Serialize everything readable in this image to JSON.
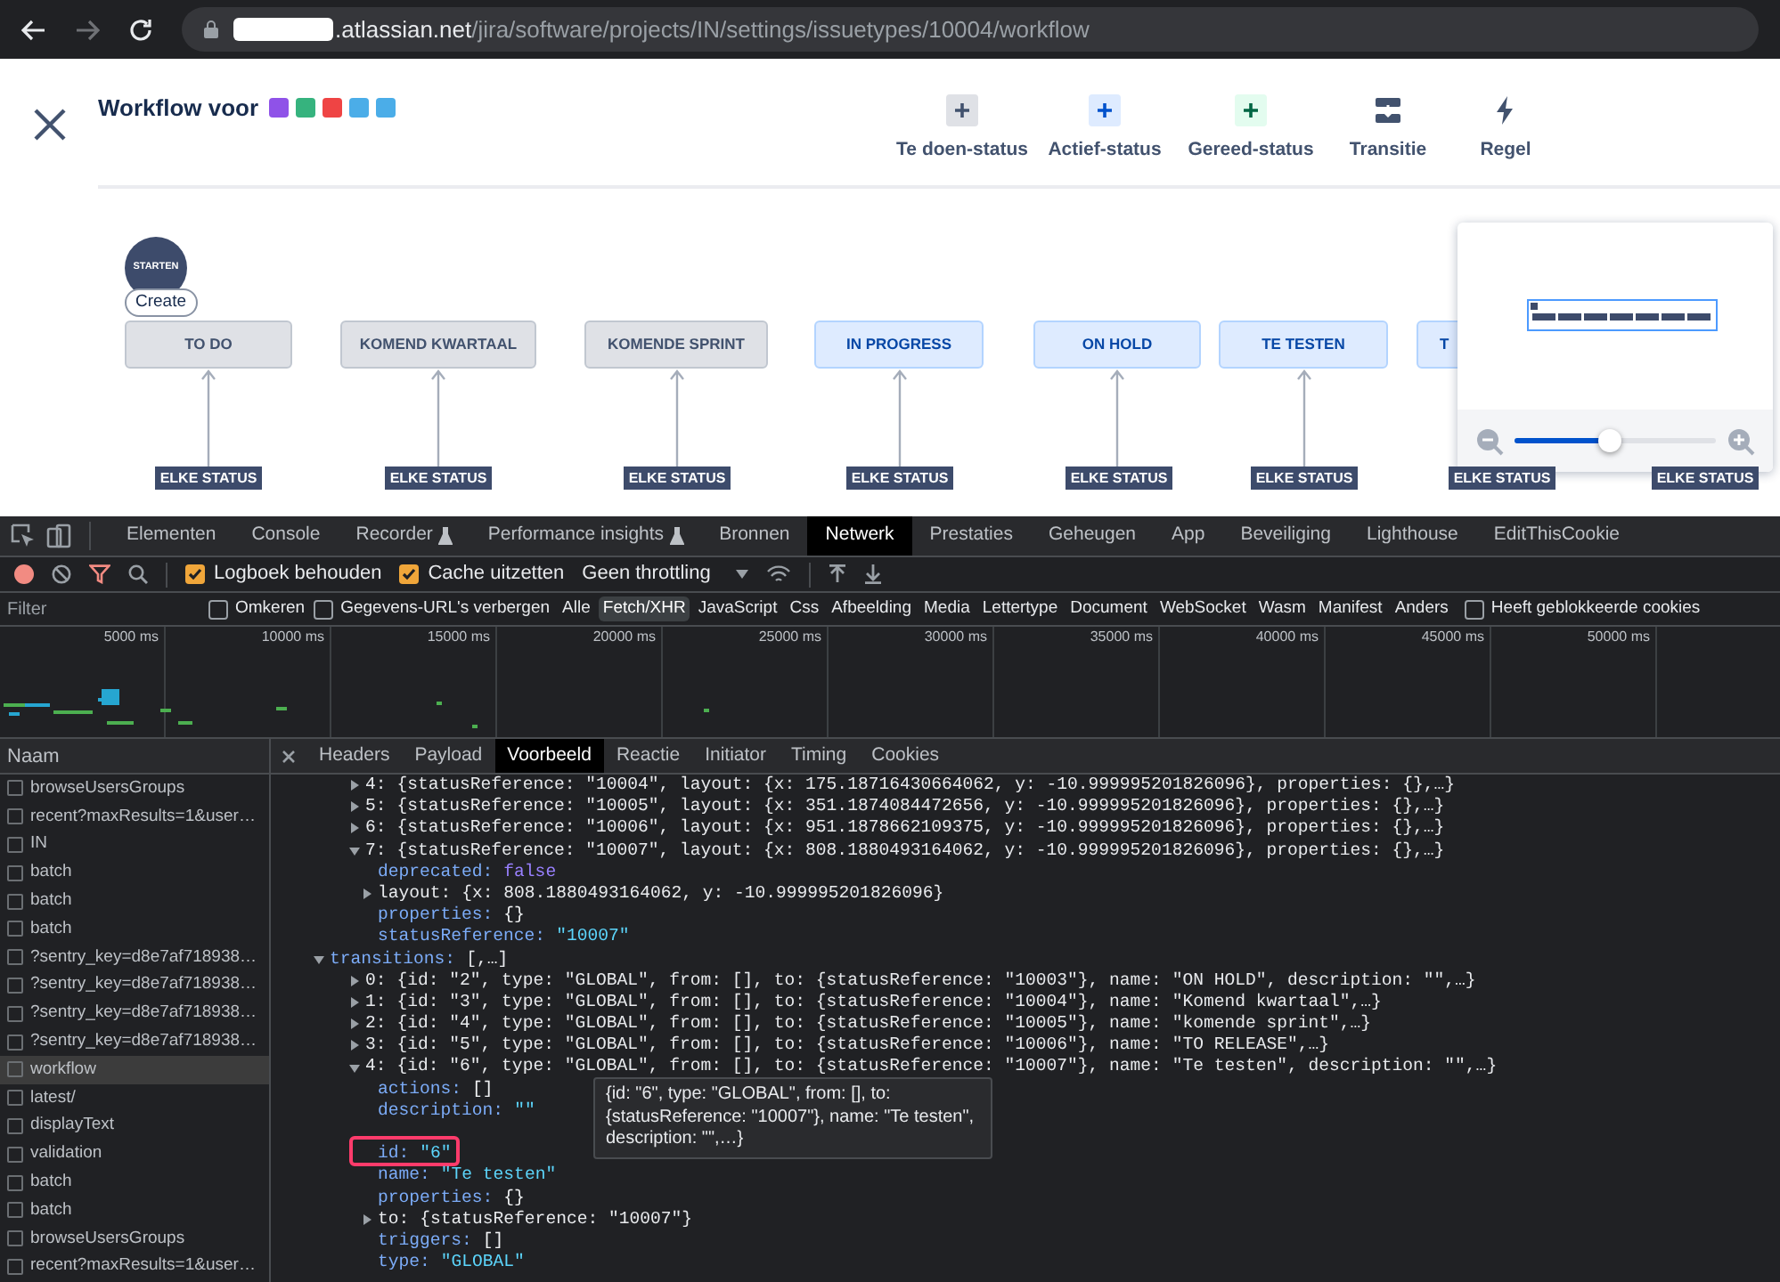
{
  "browser": {
    "url_host": ".atlassian.net",
    "url_path": "/jira/software/projects/IN/settings/issuetypes/10004/workflow"
  },
  "header": {
    "title": "Workflow voor",
    "issue_types": [
      {
        "color": "#8f52e8"
      },
      {
        "color": "#36b37e"
      },
      {
        "color": "#ef4444"
      },
      {
        "color": "#4bade8"
      },
      {
        "color": "#4bade8"
      }
    ],
    "tools": [
      {
        "label": "Te doen-status",
        "kind": "todo"
      },
      {
        "label": "Actief-status",
        "kind": "active"
      },
      {
        "label": "Gereed-status",
        "kind": "done"
      },
      {
        "label": "Transitie",
        "kind": "transition"
      },
      {
        "label": "Regel",
        "kind": "rule"
      }
    ]
  },
  "canvas": {
    "start": "STARTEN",
    "create": "Create",
    "statuses": [
      {
        "label": "TO DO",
        "kind": "todo",
        "has_arrow": true
      },
      {
        "label": "KOMEND KWARTAAL",
        "kind": "todo",
        "has_arrow": true
      },
      {
        "label": "KOMENDE SPRINT",
        "kind": "todo",
        "has_arrow": true
      },
      {
        "label": "IN PROGRESS",
        "kind": "inprogress",
        "has_arrow": true
      },
      {
        "label": "ON HOLD",
        "kind": "inprogress",
        "has_arrow": true
      },
      {
        "label": "TE TESTEN",
        "kind": "inprogress",
        "has_arrow": true
      },
      {
        "label": "T",
        "kind": "inprogress",
        "has_arrow": false
      }
    ],
    "global_labels": [
      "ELKE STATUS",
      "ELKE STATUS",
      "ELKE STATUS",
      "ELKE STATUS",
      "ELKE STATUS",
      "ELKE STATUS",
      "ELKE STATUS",
      "ELKE STATUS"
    ],
    "zoom": {
      "level": 0.47
    }
  },
  "devtools": {
    "tabs": [
      {
        "label": "Elementen",
        "selected": false,
        "lab": false
      },
      {
        "label": "Console",
        "selected": false,
        "lab": false
      },
      {
        "label": "Recorder",
        "selected": false,
        "lab": true
      },
      {
        "label": "Performance insights",
        "selected": false,
        "lab": true
      },
      {
        "label": "Bronnen",
        "selected": false,
        "lab": false
      },
      {
        "label": "Netwerk",
        "selected": true,
        "lab": false
      },
      {
        "label": "Prestaties",
        "selected": false,
        "lab": false
      },
      {
        "label": "Geheugen",
        "selected": false,
        "lab": false
      },
      {
        "label": "App",
        "selected": false,
        "lab": false
      },
      {
        "label": "Beveiliging",
        "selected": false,
        "lab": false
      },
      {
        "label": "Lighthouse",
        "selected": false,
        "lab": false
      },
      {
        "label": "EditThisCookie",
        "selected": false,
        "lab": false
      }
    ],
    "toolbar": {
      "preserve_log": {
        "label": "Logboek behouden",
        "checked": true
      },
      "disable_cache": {
        "label": "Cache uitzetten",
        "checked": true
      },
      "throttling": "Geen throttling"
    },
    "filter": {
      "placeholder": "Filter",
      "invert": {
        "label": "Omkeren",
        "checked": false
      },
      "hide_data_urls": {
        "label": "Gegevens-URL's verbergen",
        "checked": false
      },
      "types": [
        {
          "label": "Alle",
          "selected": false
        },
        {
          "label": "Fetch/XHR",
          "selected": true
        },
        {
          "label": "JavaScript",
          "selected": false
        },
        {
          "label": "Css",
          "selected": false
        },
        {
          "label": "Afbeelding",
          "selected": false
        },
        {
          "label": "Media",
          "selected": false
        },
        {
          "label": "Lettertype",
          "selected": false
        },
        {
          "label": "Document",
          "selected": false
        },
        {
          "label": "WebSocket",
          "selected": false
        },
        {
          "label": "Wasm",
          "selected": false
        },
        {
          "label": "Manifest",
          "selected": false
        },
        {
          "label": "Anders",
          "selected": false
        }
      ],
      "blocked_cookies": {
        "label": "Heeft geblokkeerde cookies",
        "checked": false
      }
    },
    "timeline_ticks": [
      "5000 ms",
      "10000 ms",
      "15000 ms",
      "20000 ms",
      "25000 ms",
      "30000 ms",
      "35000 ms",
      "40000 ms",
      "45000 ms",
      "50000 ms"
    ],
    "requests": {
      "column": "Naam",
      "rows": [
        {
          "name": "browseUsersGroups",
          "selected": false
        },
        {
          "name": "recent?maxResults=1&user…",
          "selected": false
        },
        {
          "name": "IN",
          "selected": false
        },
        {
          "name": "batch",
          "selected": false
        },
        {
          "name": "batch",
          "selected": false
        },
        {
          "name": "batch",
          "selected": false
        },
        {
          "name": "?sentry_key=d8e7af718938…",
          "selected": false
        },
        {
          "name": "?sentry_key=d8e7af718938…",
          "selected": false
        },
        {
          "name": "?sentry_key=d8e7af718938…",
          "selected": false
        },
        {
          "name": "?sentry_key=d8e7af718938…",
          "selected": false
        },
        {
          "name": "workflow",
          "selected": true
        },
        {
          "name": "latest/",
          "selected": false
        },
        {
          "name": "displayText",
          "selected": false
        },
        {
          "name": "validation",
          "selected": false
        },
        {
          "name": "batch",
          "selected": false
        },
        {
          "name": "batch",
          "selected": false
        },
        {
          "name": "browseUsersGroups",
          "selected": false
        },
        {
          "name": "recent?maxResults=1&user…",
          "selected": false
        }
      ]
    },
    "detail_tabs": [
      {
        "label": "Headers",
        "selected": false
      },
      {
        "label": "Payload",
        "selected": false
      },
      {
        "label": "Voorbeeld",
        "selected": true
      },
      {
        "label": "Reactie",
        "selected": false
      },
      {
        "label": "Initiator",
        "selected": false
      },
      {
        "label": "Timing",
        "selected": false
      },
      {
        "label": "Cookies",
        "selected": false
      }
    ],
    "preview_tail": [
      {
        "key": "4:",
        "value": "{statusReference: \"10004\", layout: {x: 175.18716430664062, y: -10.999995201826096}, properties: {},…}",
        "kind": "summary",
        "expanded": false
      },
      {
        "key": "5:",
        "value": "{statusReference: \"10005\", layout: {x: 351.1874084472656, y: -10.999995201826096}, properties: {},…}",
        "kind": "summary",
        "expanded": false
      },
      {
        "key": "6:",
        "value": "{statusReference: \"10006\", layout: {x: 951.1878662109375, y: -10.999995201826096}, properties: {},…}",
        "kind": "summary",
        "expanded": false
      },
      {
        "key": "7:",
        "value": "{statusReference: \"10007\", layout: {x: 808.1880493164062, y: -10.999995201826096}, properties: {},…}",
        "kind": "summary",
        "expanded": true,
        "children": [
          {
            "key": "deprecated:",
            "value": "false",
            "kind": "boolean"
          },
          {
            "key": "layout:",
            "value": "{x: 808.1880493164062, y: -10.999995201826096}",
            "kind": "summary",
            "expanded": false
          },
          {
            "key": "properties:",
            "value": "{}",
            "kind": "plain"
          },
          {
            "key": "statusReference:",
            "value": "\"10007\"",
            "kind": "string"
          }
        ]
      }
    ],
    "preview_tree": [
      {
        "key": "transitions:",
        "value": "[,…]",
        "kind": "summary",
        "expanded": true,
        "children": [
          {
            "key": "0:",
            "value": "{id: \"2\", type: \"GLOBAL\", from: [], to: {statusReference: \"10003\"}, name: \"ON HOLD\", description: \"\",…}",
            "kind": "summary",
            "expanded": false
          },
          {
            "key": "1:",
            "value": "{id: \"3\", type: \"GLOBAL\", from: [], to: {statusReference: \"10004\"}, name: \"Komend kwartaal\",…}",
            "kind": "summary",
            "expanded": false
          },
          {
            "key": "2:",
            "value": "{id: \"4\", type: \"GLOBAL\", from: [], to: {statusReference: \"10005\"}, name: \"komende sprint\",…}",
            "kind": "summary",
            "expanded": false
          },
          {
            "key": "3:",
            "value": "{id: \"5\", type: \"GLOBAL\", from: [], to: {statusReference: \"10006\"}, name: \"TO RELEASE\",…}",
            "kind": "summary",
            "expanded": false
          },
          {
            "key": "4:",
            "value": "{id: \"6\", type: \"GLOBAL\", from: [], to: {statusReference: \"10007\"}, name: \"Te testen\", description: \"\",…}",
            "kind": "summary",
            "expanded": true,
            "children": [
              {
                "key": "actions:",
                "value": "[]",
                "kind": "plain"
              },
              {
                "key": "description:",
                "value": "\"\"",
                "kind": "string"
              },
              {
                "key": "id:",
                "value": "\"6\"",
                "kind": "string",
                "highlighted": true,
                "gap_before": true
              },
              {
                "key": "name:",
                "value": "\"Te testen\"",
                "kind": "string"
              },
              {
                "key": "properties:",
                "value": "{}",
                "kind": "plain"
              },
              {
                "key": "to:",
                "value": "{statusReference: \"10007\"}",
                "kind": "summary",
                "expanded": false
              },
              {
                "key": "triggers:",
                "value": "[]",
                "kind": "plain"
              },
              {
                "key": "type:",
                "value": "\"GLOBAL\"",
                "kind": "string"
              }
            ]
          }
        ]
      }
    ],
    "tooltip": "{id: \"6\", type: \"GLOBAL\", from: [], to: {statusReference: \"10007\"}, name: \"Te testen\", description: \"\",…}"
  }
}
